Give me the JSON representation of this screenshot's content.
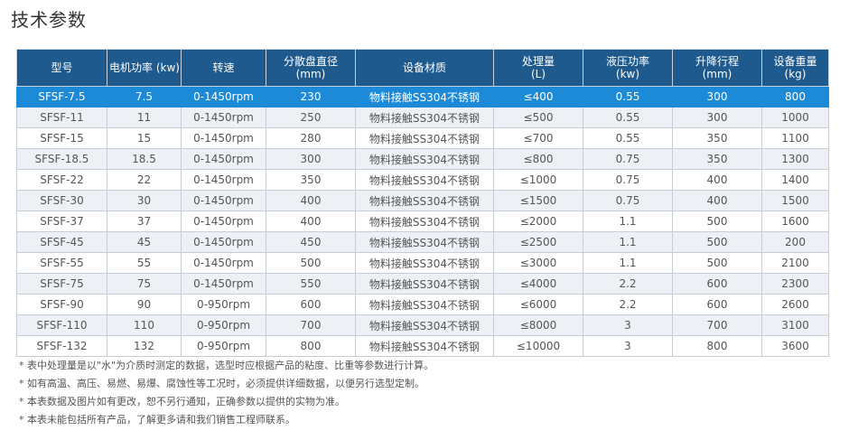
{
  "page": {
    "title": "技术参数"
  },
  "table": {
    "headers": [
      [
        "型号"
      ],
      [
        "电机功率 (kw)"
      ],
      [
        "转速"
      ],
      [
        "分散盘直径",
        "(mm)"
      ],
      [
        "设备材质"
      ],
      [
        "处理量",
        "(L)"
      ],
      [
        "液压功率",
        "(kw)"
      ],
      [
        "升降行程",
        "(mm)"
      ],
      [
        "设备重量",
        "(kg)"
      ]
    ],
    "highlighted_row": 0,
    "rows": [
      [
        "SFSF-7.5",
        "7.5",
        "0-1450rpm",
        "230",
        "物料接触SS304不锈钢",
        "≤400",
        "0.55",
        "300",
        "800"
      ],
      [
        "SFSF-11",
        "11",
        "0-1450rpm",
        "250",
        "物料接触SS304不锈钢",
        "≤500",
        "0.55",
        "300",
        "1000"
      ],
      [
        "SFSF-15",
        "15",
        "0-1450rpm",
        "280",
        "物料接触SS304不锈钢",
        "≤700",
        "0.55",
        "350",
        "1100"
      ],
      [
        "SFSF-18.5",
        "18.5",
        "0-1450rpm",
        "300",
        "物料接触SS304不锈钢",
        "≤800",
        "0.75",
        "350",
        "1300"
      ],
      [
        "SFSF-22",
        "22",
        "0-1450rpm",
        "350",
        "物料接触SS304不锈钢",
        "≤1000",
        "0.75",
        "400",
        "1400"
      ],
      [
        "SFSF-30",
        "30",
        "0-1450rpm",
        "400",
        "物料接触SS304不锈钢",
        "≤1500",
        "0.75",
        "400",
        "1500"
      ],
      [
        "SFSF-37",
        "37",
        "0-1450rpm",
        "400",
        "物料接触SS304不锈钢",
        "≤2000",
        "1.1",
        "500",
        "1600"
      ],
      [
        "SFSF-45",
        "45",
        "0-1450rpm",
        "450",
        "物料接触SS304不锈钢",
        "≤2500",
        "1.1",
        "500",
        "200"
      ],
      [
        "SFSF-55",
        "55",
        "0-1450rpm",
        "500",
        "物料接触SS304不锈钢",
        "≤3000",
        "1.1",
        "500",
        "2100"
      ],
      [
        "SFSF-75",
        "75",
        "0-1450rpm",
        "550",
        "物料接触SS304不锈钢",
        "≤4000",
        "2.2",
        "600",
        "2300"
      ],
      [
        "SFSF-90",
        "90",
        "0-950rpm",
        "600",
        "物料接触SS304不锈钢",
        "≤6000",
        "2.2",
        "600",
        "2600"
      ],
      [
        "SFSF-110",
        "110",
        "0-950rpm",
        "700",
        "物料接触SS304不锈钢",
        "≤8000",
        "3",
        "700",
        "3100"
      ],
      [
        "SFSF-132",
        "132",
        "0-950rpm",
        "800",
        "物料接触SS304不锈钢",
        "≤10000",
        "3",
        "800",
        "3600"
      ]
    ]
  },
  "footnotes": [
    "* 表中处理量是以\"水\"为介质时测定的数据，选型时应根据产品的粘度、比重等参数进行计算。",
    "* 如有高温、高压、易燃、易爆、腐蚀性等工况时，必须提供详细数据，以便另行选型定制。",
    "* 本表数据及图片如有更改，恕不另行通知，正确参数以提供的实物为准。",
    "* 本表未能包括所有产品，了解更多请和我们销售工程师联系。"
  ],
  "colors": {
    "header_bg": "#1e5a8e",
    "highlight_row_bg": "#1d8ad8",
    "alt_row_bg": "#edf1f5",
    "text": "#555555"
  }
}
